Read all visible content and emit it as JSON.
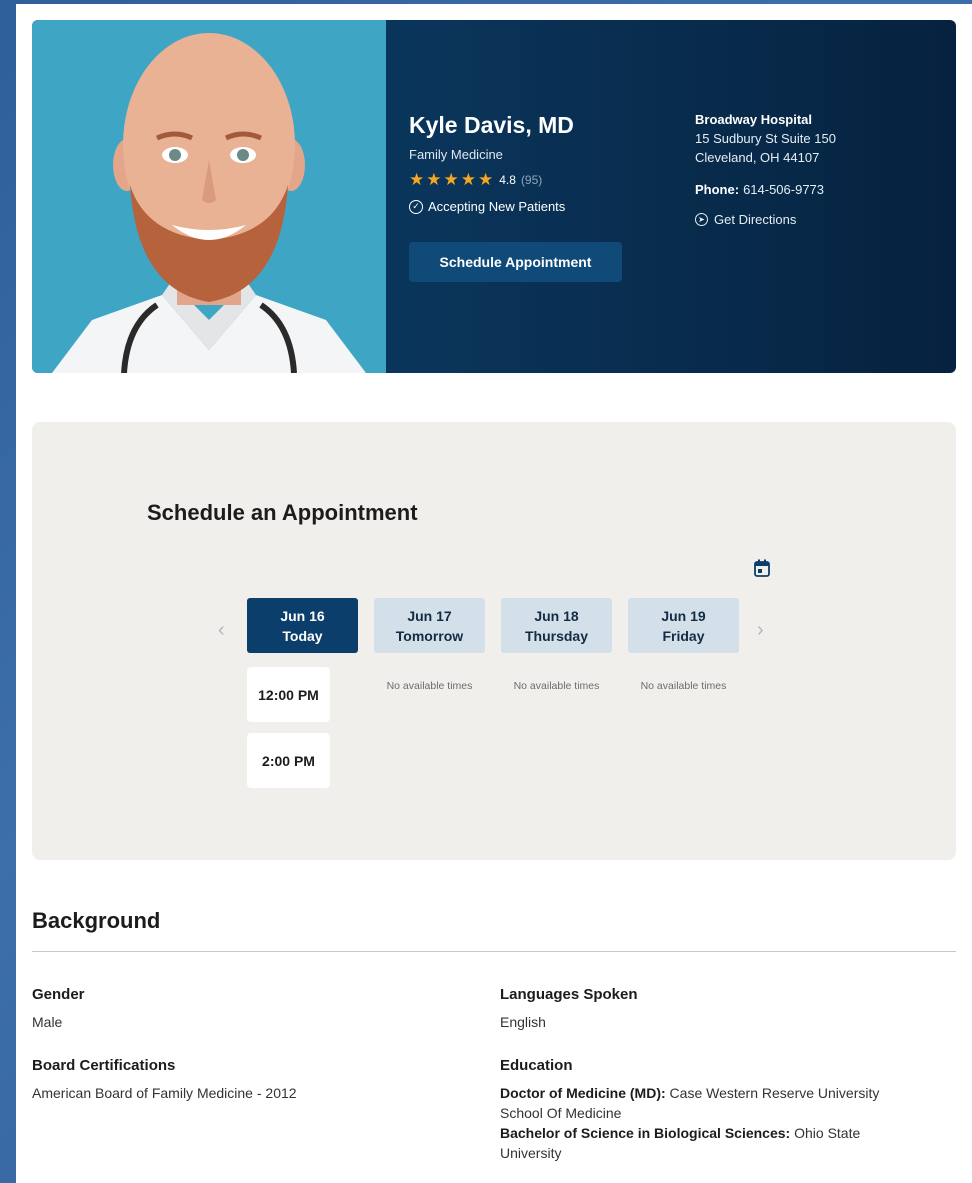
{
  "doctor": {
    "name": "Kyle Davis, MD",
    "specialty": "Family Medicine",
    "rating_value": "4.8",
    "rating_count": "(95)",
    "rating_stars": 4.8,
    "accepting": "Accepting New Patients",
    "schedule_button": "Schedule Appointment"
  },
  "location": {
    "name": "Broadway Hospital",
    "address_line1": "15 Sudbury St Suite 150",
    "address_line2": "Cleveland, OH 44107",
    "phone_label": "Phone:",
    "phone": "614-506-9773",
    "directions": "Get Directions"
  },
  "schedule": {
    "title": "Schedule an Appointment",
    "days": [
      {
        "date": "Jun 16",
        "label": "Today",
        "selected": true
      },
      {
        "date": "Jun 17",
        "label": "Tomorrow",
        "selected": false,
        "no_times": "No available times"
      },
      {
        "date": "Jun 18",
        "label": "Thursday",
        "selected": false,
        "no_times": "No available times"
      },
      {
        "date": "Jun 19",
        "label": "Friday",
        "selected": false,
        "no_times": "No available times"
      }
    ],
    "slots": [
      "12:00 PM",
      "2:00 PM"
    ]
  },
  "background": {
    "title": "Background",
    "gender_label": "Gender",
    "gender": "Male",
    "languages_label": "Languages Spoken",
    "languages": "English",
    "board_label": "Board Certifications",
    "board": "American Board of Family Medicine - 2012",
    "education_label": "Education",
    "education": [
      {
        "degree": "Doctor of Medicine (MD):",
        "school_line1": "Case Western Reserve University",
        "school_line2": "School Of Medicine"
      },
      {
        "degree": "Bachelor of Science in Biological Sciences:",
        "school_line1": "Ohio State",
        "school_line2": "University"
      }
    ]
  },
  "colors": {
    "hero_dark": "#0a3459",
    "accent_button": "#0f4a78",
    "star": "#f5a623",
    "day_selected": "#0b3e6a",
    "day_default": "#d3e0ea",
    "schedule_bg": "#f1efec"
  },
  "icons": [
    "check-circle-icon",
    "navigation-icon",
    "calendar-icon",
    "chevron-left-icon",
    "chevron-right-icon",
    "star-icon"
  ]
}
